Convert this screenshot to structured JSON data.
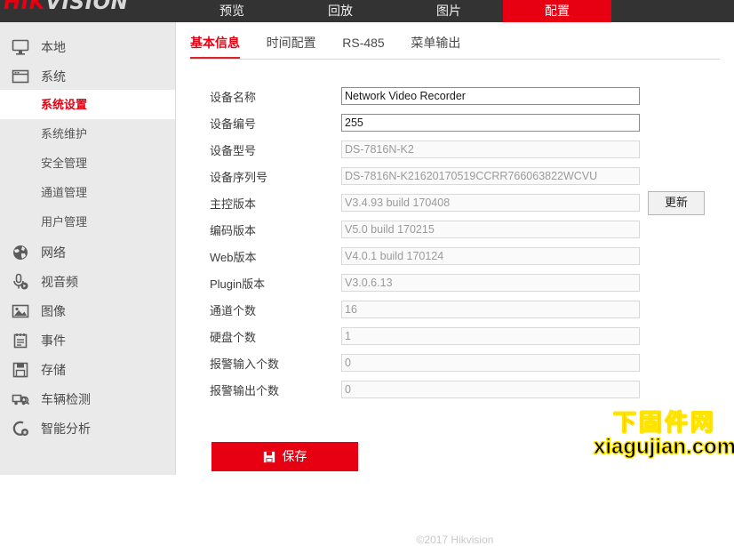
{
  "brand": {
    "part1": "HIK",
    "part2": "VISION"
  },
  "topnav": [
    {
      "label": "预览",
      "active": false
    },
    {
      "label": "回放",
      "active": false
    },
    {
      "label": "图片",
      "active": false
    },
    {
      "label": "配置",
      "active": true
    }
  ],
  "sidebar": {
    "items": [
      {
        "label": "本地",
        "icon": "monitor-icon"
      },
      {
        "label": "系统",
        "icon": "window-icon"
      }
    ],
    "subitems": [
      {
        "label": "系统设置",
        "active": true
      },
      {
        "label": "系统维护",
        "active": false
      },
      {
        "label": "安全管理",
        "active": false
      },
      {
        "label": "通道管理",
        "active": false
      },
      {
        "label": "用户管理",
        "active": false
      }
    ],
    "items2": [
      {
        "label": "网络",
        "icon": "globe-icon"
      },
      {
        "label": "视音频",
        "icon": "audio-video-icon"
      },
      {
        "label": "图像",
        "icon": "picture-icon"
      },
      {
        "label": "事件",
        "icon": "clipboard-icon"
      },
      {
        "label": "存储",
        "icon": "floppy-disk-icon"
      },
      {
        "label": "车辆检测",
        "icon": "vehicle-detect-icon"
      },
      {
        "label": "智能分析",
        "icon": "smart-analysis-icon"
      }
    ]
  },
  "content": {
    "tabs": [
      {
        "label": "基本信息",
        "active": true
      },
      {
        "label": "时间配置",
        "active": false
      },
      {
        "label": "RS-485",
        "active": false
      },
      {
        "label": "菜单输出",
        "active": false
      }
    ],
    "fields": [
      {
        "label": "设备名称",
        "value": "Network Video Recorder",
        "readonly": false
      },
      {
        "label": "设备编号",
        "value": "255",
        "readonly": false
      },
      {
        "label": "设备型号",
        "value": "DS-7816N-K2",
        "readonly": true
      },
      {
        "label": "设备序列号",
        "value": "DS-7816N-K21620170519CCRR766063822WCVU",
        "readonly": true
      },
      {
        "label": "主控版本",
        "value": "V3.4.93 build 170408",
        "readonly": true
      },
      {
        "label": "编码版本",
        "value": "V5.0 build 170215",
        "readonly": true
      },
      {
        "label": "Web版本",
        "value": "V4.0.1 build 170124",
        "readonly": true
      },
      {
        "label": "Plugin版本",
        "value": "V3.0.6.13",
        "readonly": true
      },
      {
        "label": "通道个数",
        "value": "16",
        "readonly": true
      },
      {
        "label": "硬盘个数",
        "value": "1",
        "readonly": true
      },
      {
        "label": "报警输入个数",
        "value": "0",
        "readonly": true
      },
      {
        "label": "报警输出个数",
        "value": "0",
        "readonly": true
      }
    ],
    "update_button": "更新",
    "save_button": "保存",
    "footer": "©2017 Hikvision"
  },
  "watermark": {
    "cn": "下固件网",
    "en": "xiagujian.com"
  },
  "colors": {
    "accent": "#e60012",
    "topbar": "#333333",
    "sidebar": "#eaeaea"
  }
}
